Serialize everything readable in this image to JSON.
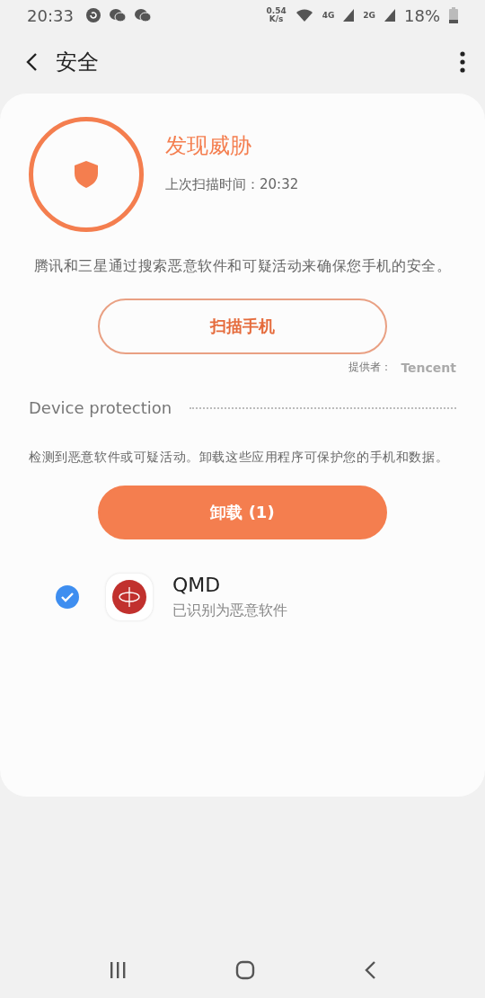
{
  "status_bar": {
    "time": "20:33",
    "speed": "0.54",
    "speed_unit": "K/s",
    "network_1": "4G",
    "network_2": "2G",
    "battery": "18%"
  },
  "header": {
    "title": "安全"
  },
  "status": {
    "title": "发现威胁",
    "last_scan": "上次扫描时间：20:32"
  },
  "description": "腾讯和三星通过搜索恶意软件和可疑活动来确保您手机的安全。",
  "scan_button": "扫描手机",
  "provider": {
    "label": "提供者：",
    "name": "Tencent"
  },
  "section": {
    "title": "Device protection",
    "description": "检测到恶意软件或可疑活动。卸载这些应用程序可保护您的手机和数据。"
  },
  "uninstall_button": "卸载 (1)",
  "apps": [
    {
      "name": "QMD",
      "note": "已识别为恶意软件",
      "checked": true
    }
  ]
}
